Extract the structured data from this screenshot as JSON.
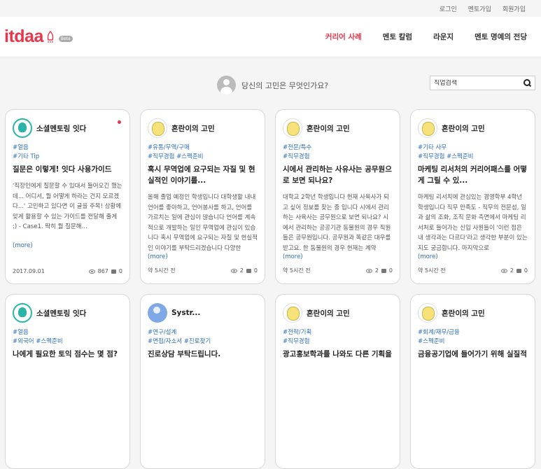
{
  "topbar": {
    "login": "로그인",
    "mentor_signup": "멘토가입",
    "member_signup": "회원가입"
  },
  "logo": {
    "text": "itdaa",
    "badge": "Beta"
  },
  "nav": [
    "커리어 사례",
    "멘토 칼럼",
    "라운지",
    "멘토 명예의 전당"
  ],
  "question": "당신의 고민은 무엇인가요?",
  "search": {
    "placeholder": "직업검색"
  },
  "cards": [
    {
      "author": "소셜멘토링 잇다",
      "avatar": "teal",
      "tags": "#얼음\n#기타 Tip",
      "title": "질문은 이렇게! 잇다 사용가이드",
      "body": "'직장인에게 질문할 수 있대서 들어오긴 했는데... 어디서, 뭘 어떻게 하라는 건지 모르겠다...' 고민하고 있다면 이 글을 주목! 상황에 맞게 활용할 수 있는 가이드를 전달해 줄게 :) - Case1. 딱히 뭘 질문해...",
      "more": "(more)",
      "date": "2017.09.01",
      "views": "867",
      "comments": "0",
      "new": true
    },
    {
      "author": "혼란이의 고민",
      "avatar": "yellow",
      "tags": "#유통/무역/구매\n#직무경험 #스펙준비",
      "title": "혹시 무역업에 요구되는 자질 및 현실적인 이야기를...",
      "body": "올해 졸업 예정인 학생입니다 대학생활 내내 언어를 좋아하고, 언어봉사를 하고, 언어를 가르치는 일에 관심이 많습니다 언어를 계속적으로 개발하는 일인 무역업에 관심이 있습니다 혹시 무역업에 요구되는 자질 및 현실적인 이야기를 부탁드리겠습니다 다양한",
      "more": "(more)",
      "date": "약 5시간 전",
      "views": "2",
      "comments": "0",
      "new": false
    },
    {
      "author": "혼란이의 고민",
      "avatar": "yellow",
      "tags": "#전문/특수\n#직무경험",
      "title": "시에서 관리하는 사유사는 공무원으로 보면 되나요?",
      "body": "대학교 2학년 학생입니다 현재 사육사가 되고 싶어 정보를 찾는 중 입니다 시에서 관리하는 사육사는 공무원으로 보면 되나요? 시에서 관리하는 공공기관 동물원의 경우 직원들은 공무원입니다. 공무원과 똑같은 대우를 받고요. 한 동물원의 경우 현재는 계약",
      "more": "(more)",
      "date": "약 5시간 전",
      "views": "2",
      "comments": "0",
      "new": false
    },
    {
      "author": "혼란이의 고민",
      "avatar": "yellow",
      "tags": "#기타 사무\n#직무경험 #스펙준비",
      "title": "마케팅 리서처의 커리어패스를 어떻게 그릴 수 있...",
      "body": "마케팅 리서치에 관심있는 경영학부 4학년 학생입니다 직무 만족도 - 직무의 전문성, 일과 삶의 조화, 조직 문화 측면에서 마케팅 리서처로 들어가는 신입 사원들이 '이런 점은 내 생각과는 다르다'라고 생각한 부분이 있는지도 궁금합니다. 마지막으로",
      "more": "(more)",
      "date": "약 5시간 전",
      "views": "2",
      "comments": "0",
      "new": false
    },
    {
      "author": "소셜멘토링 잇다",
      "avatar": "teal",
      "tags": "#얼음\n#외국어 #스펙준비",
      "title": "나에게 필요한 토익 점수는 몇 점?",
      "body": "",
      "more": "",
      "date": "",
      "views": "",
      "comments": "",
      "new": false
    },
    {
      "author": "Systr...",
      "avatar": "blue",
      "tags": "#연구/설계\n#면접/자소서 #진로찾기",
      "title": "진로상담 부탁드립니다.",
      "body": "",
      "more": "",
      "date": "",
      "views": "",
      "comments": "",
      "new": false
    },
    {
      "author": "혼란이의 고민",
      "avatar": "yellow",
      "tags": "#전략/기획\n#직무경험",
      "title": "광고홍보학과를 나와도 다른 기획을",
      "body": "",
      "more": "",
      "date": "",
      "views": "",
      "comments": "",
      "new": false
    },
    {
      "author": "혼란이의 고민",
      "avatar": "yellow",
      "tags": "#회계/재무/금융\n#스펙준비",
      "title": "금융공기업에 들어가기 위해 실질적",
      "body": "",
      "more": "",
      "date": "",
      "views": "",
      "comments": "",
      "new": false
    }
  ]
}
